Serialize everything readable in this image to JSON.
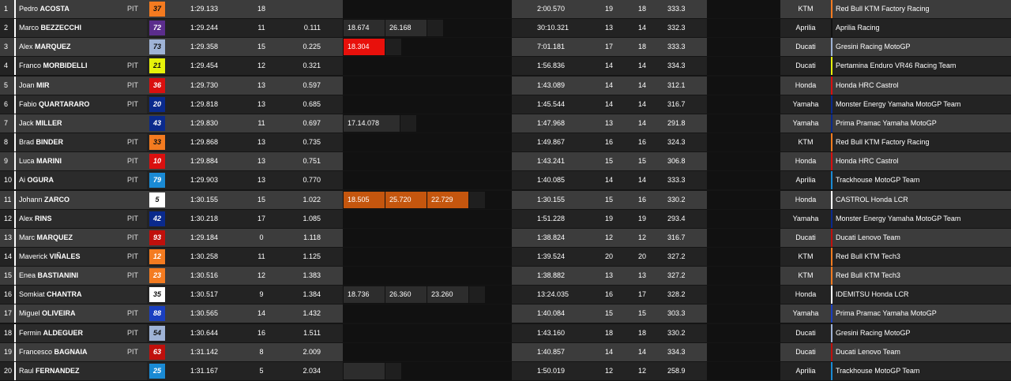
{
  "rows": [
    {
      "pos": "1",
      "first": "Pedro",
      "last": "ACOSTA",
      "pit": "PIT",
      "num": "37",
      "num_bg": "#f47b20",
      "num_fg": "#111",
      "best": "1:29.133",
      "best_lap": "18",
      "gap": "",
      "sectors": [],
      "last_time": "2:00.570",
      "laps": "19",
      "lap2": "18",
      "speed": "333.3",
      "make": "KTM",
      "team": "Red Bull KTM Factory Racing",
      "team_color": "#f47b20"
    },
    {
      "pos": "2",
      "first": "Marco",
      "last": "BEZZECCHI",
      "pit": "",
      "num": "72",
      "num_bg": "#5b2d8c",
      "num_fg": "#fff",
      "best": "1:29.244",
      "best_lap": "11",
      "gap": "0.111",
      "sectors": [
        {
          "v": "18.674",
          "c": "#2d2d2d"
        },
        {
          "v": "26.168",
          "c": "#2d2d2d"
        }
      ],
      "last_time": "30:10.321",
      "laps": "13",
      "lap2": "14",
      "speed": "332.3",
      "make": "Aprilia",
      "team": "Aprilia Racing",
      "team_color": "#111"
    },
    {
      "pos": "3",
      "first": "Alex",
      "last": "MARQUEZ",
      "pit": "",
      "num": "73",
      "num_bg": "#9fb3d6",
      "num_fg": "#111",
      "best": "1:29.358",
      "best_lap": "15",
      "gap": "0.225",
      "sectors": [
        {
          "v": "18.304",
          "c": "#e8100b"
        }
      ],
      "last_time": "7:01.181",
      "laps": "17",
      "lap2": "18",
      "speed": "333.3",
      "make": "Ducati",
      "team": "Gresini Racing MotoGP",
      "team_color": "#9fb3d6"
    },
    {
      "pos": "4",
      "first": "Franco",
      "last": "MORBIDELLI",
      "pit": "PIT",
      "num": "21",
      "num_bg": "#e6f20a",
      "num_fg": "#111",
      "best": "1:29.454",
      "best_lap": "12",
      "gap": "0.321",
      "sectors": [],
      "last_time": "1:56.836",
      "laps": "14",
      "lap2": "14",
      "speed": "334.3",
      "make": "Ducati",
      "team": "Pertamina Enduro VR46 Racing Team",
      "team_color": "#e6f20a"
    },
    {
      "pos": "5",
      "first": "Joan",
      "last": "MIR",
      "pit": "PIT",
      "num": "36",
      "num_bg": "#d9100f",
      "num_fg": "#fff",
      "best": "1:29.730",
      "best_lap": "13",
      "gap": "0.597",
      "sectors": [],
      "last_time": "1:43.089",
      "laps": "14",
      "lap2": "14",
      "speed": "312.1",
      "make": "Honda",
      "team": "Honda HRC Castrol",
      "team_color": "#d9100f"
    },
    {
      "pos": "6",
      "first": "Fabio",
      "last": "QUARTARARO",
      "pit": "PIT",
      "num": "20",
      "num_bg": "#0a2a8c",
      "num_fg": "#fff",
      "best": "1:29.818",
      "best_lap": "13",
      "gap": "0.685",
      "sectors": [],
      "last_time": "1:45.544",
      "laps": "14",
      "lap2": "14",
      "speed": "316.7",
      "make": "Yamaha",
      "team": "Monster Energy Yamaha MotoGP Team",
      "team_color": "#0a2a8c"
    },
    {
      "pos": "7",
      "first": "Jack",
      "last": "MILLER",
      "pit": "",
      "num": "43",
      "num_bg": "#0a2a8c",
      "num_fg": "#fff",
      "best": "1:29.830",
      "best_lap": "11",
      "gap": "0.697",
      "sectors": [
        {
          "v": "17.14.078",
          "c": "#2d2d2d"
        }
      ],
      "last_time": "1:47.968",
      "laps": "13",
      "lap2": "14",
      "speed": "291.8",
      "make": "Yamaha",
      "team": "Prima Pramac Yamaha MotoGP",
      "team_color": "#0a2a8c"
    },
    {
      "pos": "8",
      "first": "Brad",
      "last": "BINDER",
      "pit": "PIT",
      "num": "33",
      "num_bg": "#f47b20",
      "num_fg": "#111",
      "best": "1:29.868",
      "best_lap": "13",
      "gap": "0.735",
      "sectors": [],
      "last_time": "1:49.867",
      "laps": "16",
      "lap2": "16",
      "speed": "324.3",
      "make": "KTM",
      "team": "Red Bull KTM Factory Racing",
      "team_color": "#f47b20"
    },
    {
      "pos": "9",
      "first": "Luca",
      "last": "MARINI",
      "pit": "PIT",
      "num": "10",
      "num_bg": "#d9100f",
      "num_fg": "#fff",
      "best": "1:29.884",
      "best_lap": "13",
      "gap": "0.751",
      "sectors": [],
      "last_time": "1:43.241",
      "laps": "15",
      "lap2": "15",
      "speed": "306.8",
      "make": "Honda",
      "team": "Honda HRC Castrol",
      "team_color": "#d9100f"
    },
    {
      "pos": "10",
      "first": "Ai",
      "last": "OGURA",
      "pit": "PIT",
      "num": "79",
      "num_bg": "#1a8ad4",
      "num_fg": "#fff",
      "best": "1:29.903",
      "best_lap": "13",
      "gap": "0.770",
      "sectors": [],
      "last_time": "1:40.085",
      "laps": "14",
      "lap2": "14",
      "speed": "333.3",
      "make": "Aprilia",
      "team": "Trackhouse MotoGP Team",
      "team_color": "#1a8ad4"
    },
    {
      "pos": "11",
      "first": "Johann",
      "last": "ZARCO",
      "pit": "",
      "num": "5",
      "num_bg": "#ffffff",
      "num_fg": "#111",
      "best": "1:30.155",
      "best_lap": "15",
      "gap": "1.022",
      "sectors": [
        {
          "v": "18.505",
          "c": "#c5560e"
        },
        {
          "v": "25.720",
          "c": "#c5560e"
        },
        {
          "v": "22.729",
          "c": "#c5560e"
        }
      ],
      "last_time": "1:30.155",
      "laps": "15",
      "lap2": "16",
      "speed": "330.2",
      "make": "Honda",
      "team": "CASTROL Honda LCR",
      "team_color": "#ffffff"
    },
    {
      "pos": "12",
      "first": "Alex",
      "last": "RINS",
      "pit": "PIT",
      "num": "42",
      "num_bg": "#0a2a8c",
      "num_fg": "#fff",
      "best": "1:30.218",
      "best_lap": "17",
      "gap": "1.085",
      "sectors": [],
      "last_time": "1:51.228",
      "laps": "19",
      "lap2": "19",
      "speed": "293.4",
      "make": "Yamaha",
      "team": "Monster Energy Yamaha MotoGP Team",
      "team_color": "#0a2a8c"
    },
    {
      "pos": "13",
      "first": "Marc",
      "last": "MARQUEZ",
      "pit": "PIT",
      "num": "93",
      "num_bg": "#c0100c",
      "num_fg": "#fff",
      "best": "1:29.184",
      "best_lap": "0",
      "gap": "1.118",
      "sectors": [],
      "last_time": "1:38.824",
      "laps": "12",
      "lap2": "12",
      "speed": "316.7",
      "make": "Ducati",
      "team": "Ducati Lenovo Team",
      "team_color": "#c0100c"
    },
    {
      "pos": "14",
      "first": "Maverick",
      "last": "VIÑALES",
      "pit": "PIT",
      "num": "12",
      "num_bg": "#f47b20",
      "num_fg": "#fff",
      "best": "1:30.258",
      "best_lap": "11",
      "gap": "1.125",
      "sectors": [],
      "last_time": "1:39.524",
      "laps": "20",
      "lap2": "20",
      "speed": "327.2",
      "make": "KTM",
      "team": "Red Bull KTM Tech3",
      "team_color": "#f47b20"
    },
    {
      "pos": "15",
      "first": "Enea",
      "last": "BASTIANINI",
      "pit": "PIT",
      "num": "23",
      "num_bg": "#f47b20",
      "num_fg": "#fff",
      "best": "1:30.516",
      "best_lap": "12",
      "gap": "1.383",
      "sectors": [],
      "last_time": "1:38.882",
      "laps": "13",
      "lap2": "13",
      "speed": "327.2",
      "make": "KTM",
      "team": "Red Bull KTM Tech3",
      "team_color": "#f47b20"
    },
    {
      "pos": "16",
      "first": "Somkiat",
      "last": "CHANTRA",
      "pit": "",
      "num": "35",
      "num_bg": "#ffffff",
      "num_fg": "#111",
      "best": "1:30.517",
      "best_lap": "9",
      "gap": "1.384",
      "sectors": [
        {
          "v": "18.736",
          "c": "#2d2d2d"
        },
        {
          "v": "26.360",
          "c": "#2d2d2d"
        },
        {
          "v": "23.260",
          "c": "#2d2d2d"
        }
      ],
      "last_time": "13:24.035",
      "laps": "16",
      "lap2": "17",
      "speed": "328.2",
      "make": "Honda",
      "team": "IDEMITSU Honda LCR",
      "team_color": "#ffffff"
    },
    {
      "pos": "17",
      "first": "Miguel",
      "last": "OLIVEIRA",
      "pit": "PIT",
      "num": "88",
      "num_bg": "#1a3fc0",
      "num_fg": "#fff",
      "best": "1:30.565",
      "best_lap": "14",
      "gap": "1.432",
      "sectors": [],
      "last_time": "1:40.084",
      "laps": "15",
      "lap2": "15",
      "speed": "303.3",
      "make": "Yamaha",
      "team": "Prima Pramac Yamaha MotoGP",
      "team_color": "#1a3fc0"
    },
    {
      "pos": "18",
      "first": "Fermin",
      "last": "ALDEGUER",
      "pit": "PIT",
      "num": "54",
      "num_bg": "#9fb3d6",
      "num_fg": "#111",
      "best": "1:30.644",
      "best_lap": "16",
      "gap": "1.511",
      "sectors": [],
      "last_time": "1:43.160",
      "laps": "18",
      "lap2": "18",
      "speed": "330.2",
      "make": "Ducati",
      "team": "Gresini Racing MotoGP",
      "team_color": "#9fb3d6"
    },
    {
      "pos": "19",
      "first": "Francesco",
      "last": "BAGNAIA",
      "pit": "PIT",
      "num": "63",
      "num_bg": "#c0100c",
      "num_fg": "#fff",
      "best": "1:31.142",
      "best_lap": "8",
      "gap": "2.009",
      "sectors": [],
      "last_time": "1:40.857",
      "laps": "14",
      "lap2": "14",
      "speed": "334.3",
      "make": "Ducati",
      "team": "Ducati Lenovo Team",
      "team_color": "#c0100c"
    },
    {
      "pos": "20",
      "first": "Raul",
      "last": "FERNANDEZ",
      "pit": "",
      "num": "25",
      "num_bg": "#1a8ad4",
      "num_fg": "#fff",
      "best": "1:31.167",
      "best_lap": "5",
      "gap": "2.034",
      "sectors": [
        {
          "v": "",
          "c": "#2d2d2d"
        }
      ],
      "last_time": "1:50.019",
      "laps": "12",
      "lap2": "12",
      "speed": "258.9",
      "make": "Aprilia",
      "team": "Trackhouse MotoGP Team",
      "team_color": "#1a8ad4"
    }
  ]
}
